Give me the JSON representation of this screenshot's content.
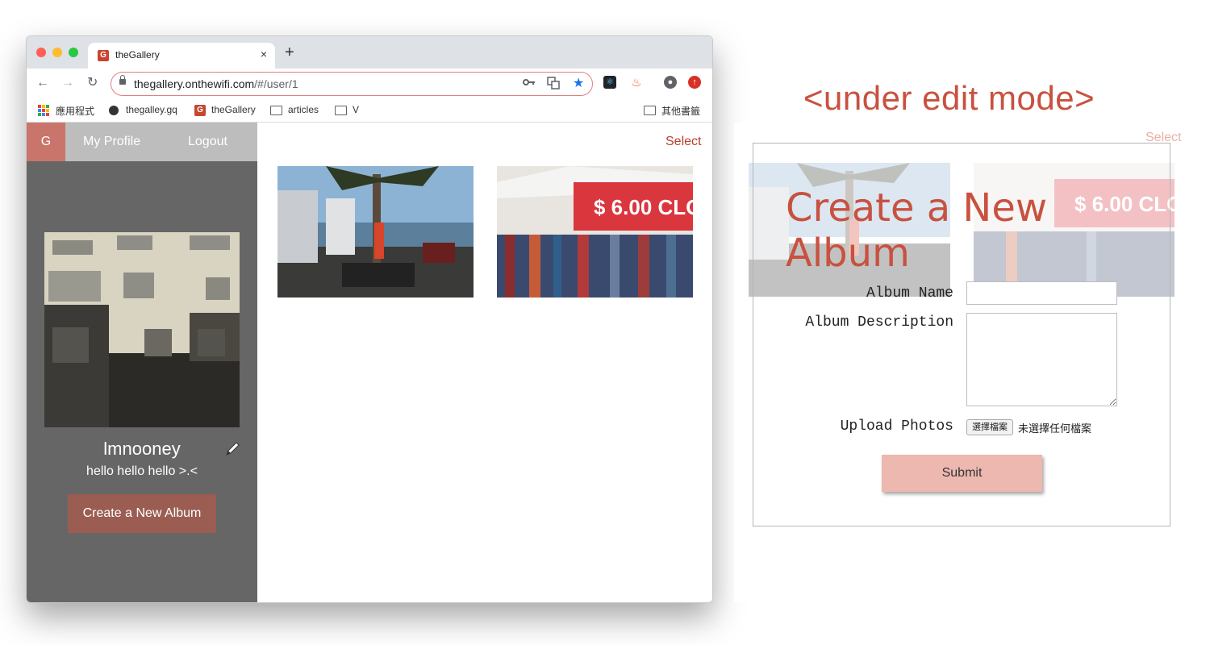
{
  "browser": {
    "tab_title": "theGallery",
    "tab_favicon": "G",
    "tab_close": "×",
    "new_tab": "+",
    "url_host": "thegallery.onthewifi.com",
    "url_path": "/#/user/1",
    "nav": {
      "back": "←",
      "forward": "→",
      "reload": "↻"
    },
    "bookmarks": [
      {
        "label": "應用程式",
        "icon": "apps-grid-icon"
      },
      {
        "label": "thegalley.gq",
        "icon": "globe-icon"
      },
      {
        "label": "theGallery",
        "icon": "gallery-favicon-icon"
      },
      {
        "label": "articles",
        "icon": "folder-icon"
      },
      {
        "label": "V",
        "icon": "folder-icon"
      }
    ],
    "other_bookmarks": "其他書籤"
  },
  "app": {
    "logo": "G",
    "nav": {
      "profile": "My Profile",
      "logout": "Logout"
    },
    "profile": {
      "username": "lmnooney",
      "bio": "hello hello hello >.<"
    },
    "create_album_button": "Create a New Album",
    "select_link": "Select"
  },
  "edit_mode": {
    "heading": "<under edit mode>",
    "select_link": "Select",
    "modal": {
      "title_line1": "Create a New",
      "title_line2": "Album",
      "album_name_label": "Album Name",
      "album_description_label": "Album Description",
      "upload_label": "Upload Photos",
      "file_button": "選擇檔案",
      "file_status": "未選擇任何檔案",
      "submit": "Submit"
    }
  },
  "colors": {
    "accent": "#c8513f",
    "sidebar": "#666666",
    "create_button": "#9b5d52",
    "submit_button": "#ecb8b0"
  }
}
